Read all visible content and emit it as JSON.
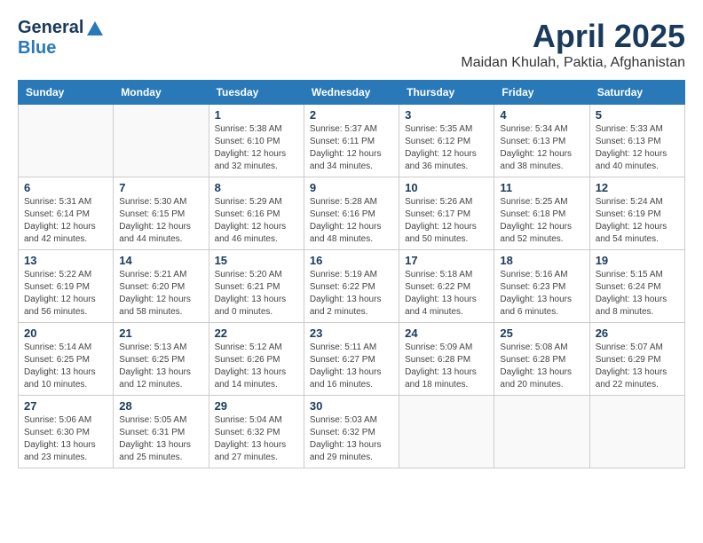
{
  "header": {
    "logo_general": "General",
    "logo_blue": "Blue",
    "month_title": "April 2025",
    "location": "Maidan Khulah, Paktia, Afghanistan"
  },
  "weekdays": [
    "Sunday",
    "Monday",
    "Tuesday",
    "Wednesday",
    "Thursday",
    "Friday",
    "Saturday"
  ],
  "weeks": [
    [
      {
        "day": "",
        "detail": ""
      },
      {
        "day": "",
        "detail": ""
      },
      {
        "day": "1",
        "detail": "Sunrise: 5:38 AM\nSunset: 6:10 PM\nDaylight: 12 hours\nand 32 minutes."
      },
      {
        "day": "2",
        "detail": "Sunrise: 5:37 AM\nSunset: 6:11 PM\nDaylight: 12 hours\nand 34 minutes."
      },
      {
        "day": "3",
        "detail": "Sunrise: 5:35 AM\nSunset: 6:12 PM\nDaylight: 12 hours\nand 36 minutes."
      },
      {
        "day": "4",
        "detail": "Sunrise: 5:34 AM\nSunset: 6:13 PM\nDaylight: 12 hours\nand 38 minutes."
      },
      {
        "day": "5",
        "detail": "Sunrise: 5:33 AM\nSunset: 6:13 PM\nDaylight: 12 hours\nand 40 minutes."
      }
    ],
    [
      {
        "day": "6",
        "detail": "Sunrise: 5:31 AM\nSunset: 6:14 PM\nDaylight: 12 hours\nand 42 minutes."
      },
      {
        "day": "7",
        "detail": "Sunrise: 5:30 AM\nSunset: 6:15 PM\nDaylight: 12 hours\nand 44 minutes."
      },
      {
        "day": "8",
        "detail": "Sunrise: 5:29 AM\nSunset: 6:16 PM\nDaylight: 12 hours\nand 46 minutes."
      },
      {
        "day": "9",
        "detail": "Sunrise: 5:28 AM\nSunset: 6:16 PM\nDaylight: 12 hours\nand 48 minutes."
      },
      {
        "day": "10",
        "detail": "Sunrise: 5:26 AM\nSunset: 6:17 PM\nDaylight: 12 hours\nand 50 minutes."
      },
      {
        "day": "11",
        "detail": "Sunrise: 5:25 AM\nSunset: 6:18 PM\nDaylight: 12 hours\nand 52 minutes."
      },
      {
        "day": "12",
        "detail": "Sunrise: 5:24 AM\nSunset: 6:19 PM\nDaylight: 12 hours\nand 54 minutes."
      }
    ],
    [
      {
        "day": "13",
        "detail": "Sunrise: 5:22 AM\nSunset: 6:19 PM\nDaylight: 12 hours\nand 56 minutes."
      },
      {
        "day": "14",
        "detail": "Sunrise: 5:21 AM\nSunset: 6:20 PM\nDaylight: 12 hours\nand 58 minutes."
      },
      {
        "day": "15",
        "detail": "Sunrise: 5:20 AM\nSunset: 6:21 PM\nDaylight: 13 hours\nand 0 minutes."
      },
      {
        "day": "16",
        "detail": "Sunrise: 5:19 AM\nSunset: 6:22 PM\nDaylight: 13 hours\nand 2 minutes."
      },
      {
        "day": "17",
        "detail": "Sunrise: 5:18 AM\nSunset: 6:22 PM\nDaylight: 13 hours\nand 4 minutes."
      },
      {
        "day": "18",
        "detail": "Sunrise: 5:16 AM\nSunset: 6:23 PM\nDaylight: 13 hours\nand 6 minutes."
      },
      {
        "day": "19",
        "detail": "Sunrise: 5:15 AM\nSunset: 6:24 PM\nDaylight: 13 hours\nand 8 minutes."
      }
    ],
    [
      {
        "day": "20",
        "detail": "Sunrise: 5:14 AM\nSunset: 6:25 PM\nDaylight: 13 hours\nand 10 minutes."
      },
      {
        "day": "21",
        "detail": "Sunrise: 5:13 AM\nSunset: 6:25 PM\nDaylight: 13 hours\nand 12 minutes."
      },
      {
        "day": "22",
        "detail": "Sunrise: 5:12 AM\nSunset: 6:26 PM\nDaylight: 13 hours\nand 14 minutes."
      },
      {
        "day": "23",
        "detail": "Sunrise: 5:11 AM\nSunset: 6:27 PM\nDaylight: 13 hours\nand 16 minutes."
      },
      {
        "day": "24",
        "detail": "Sunrise: 5:09 AM\nSunset: 6:28 PM\nDaylight: 13 hours\nand 18 minutes."
      },
      {
        "day": "25",
        "detail": "Sunrise: 5:08 AM\nSunset: 6:28 PM\nDaylight: 13 hours\nand 20 minutes."
      },
      {
        "day": "26",
        "detail": "Sunrise: 5:07 AM\nSunset: 6:29 PM\nDaylight: 13 hours\nand 22 minutes."
      }
    ],
    [
      {
        "day": "27",
        "detail": "Sunrise: 5:06 AM\nSunset: 6:30 PM\nDaylight: 13 hours\nand 23 minutes."
      },
      {
        "day": "28",
        "detail": "Sunrise: 5:05 AM\nSunset: 6:31 PM\nDaylight: 13 hours\nand 25 minutes."
      },
      {
        "day": "29",
        "detail": "Sunrise: 5:04 AM\nSunset: 6:32 PM\nDaylight: 13 hours\nand 27 minutes."
      },
      {
        "day": "30",
        "detail": "Sunrise: 5:03 AM\nSunset: 6:32 PM\nDaylight: 13 hours\nand 29 minutes."
      },
      {
        "day": "",
        "detail": ""
      },
      {
        "day": "",
        "detail": ""
      },
      {
        "day": "",
        "detail": ""
      }
    ]
  ]
}
